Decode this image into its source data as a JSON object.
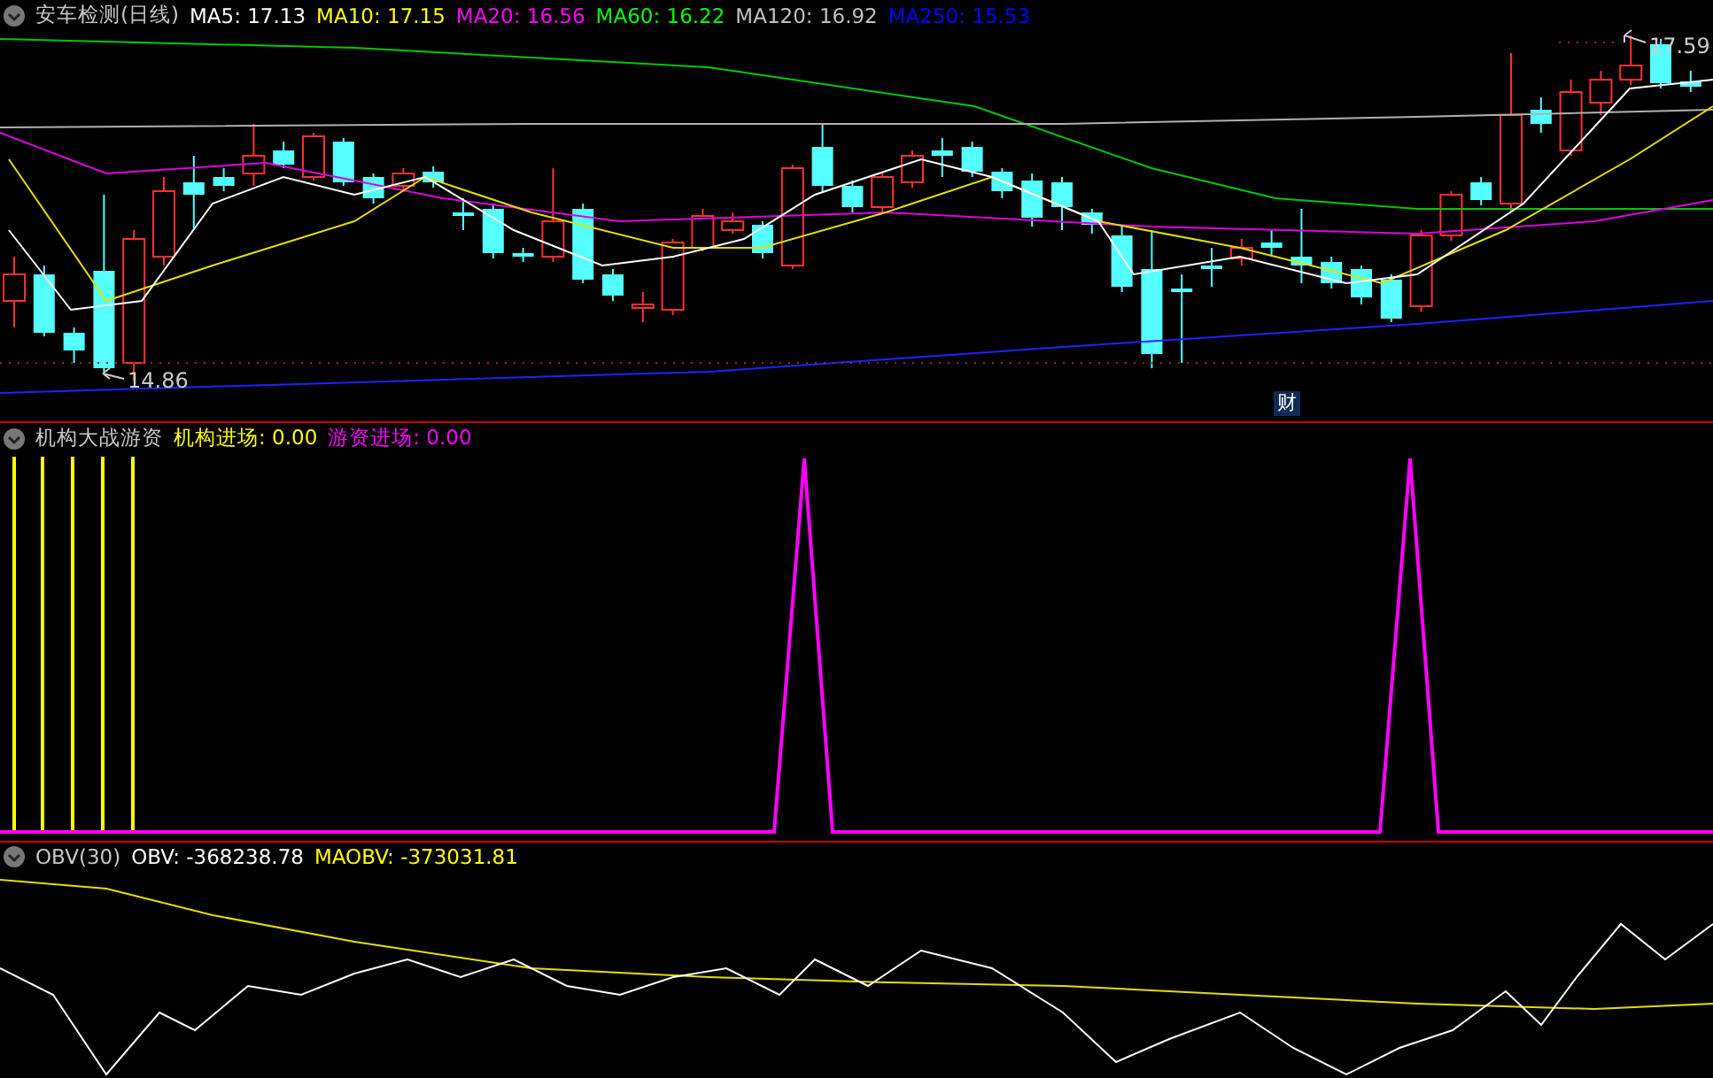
{
  "main_panel": {
    "title": "安车检测(日线)",
    "indicators": [
      {
        "label": "MA5: 17.13",
        "color": "#ffffff"
      },
      {
        "label": "MA10: 17.15",
        "color": "#ffff00"
      },
      {
        "label": "MA20: 16.56",
        "color": "#ff00ff"
      },
      {
        "label": "MA60: 16.22",
        "color": "#00ff00"
      },
      {
        "label": "MA120: 16.92",
        "color": "#c0c0c0"
      },
      {
        "label": "MA250: 15.53",
        "color": "#0000ff"
      }
    ],
    "high_label": "17.59",
    "low_label": "14.86",
    "event_marker": "财"
  },
  "signal_panel": {
    "title": "机构大战游资",
    "indicators": [
      {
        "label": "机构进场: 0.00",
        "color": "#ffff00"
      },
      {
        "label": "游资进场: 0.00",
        "color": "#ff00ff"
      }
    ]
  },
  "obv_panel": {
    "title": "OBV(30)",
    "indicators": [
      {
        "label": "OBV: -368238.78",
        "color": "#ffffff"
      },
      {
        "label": "MAOBV: -373031.81",
        "color": "#ffff00"
      }
    ]
  }
}
